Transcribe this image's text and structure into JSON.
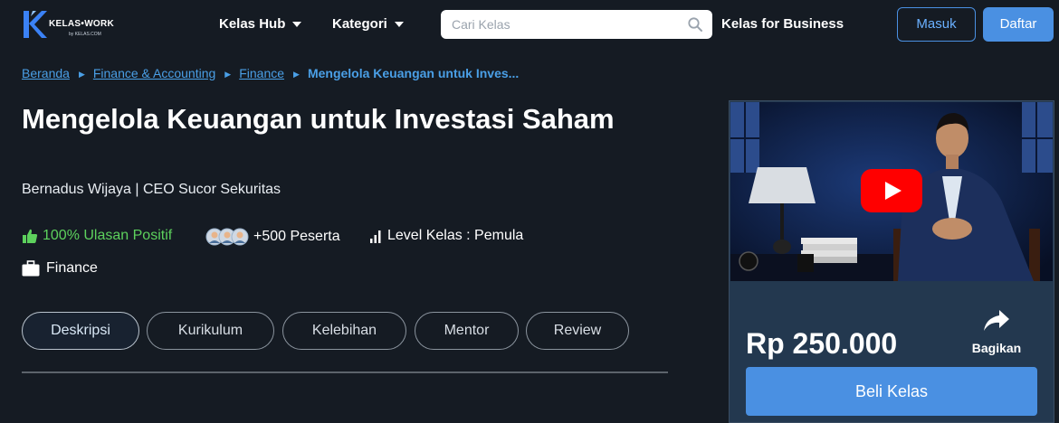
{
  "logo": {
    "brand": "KELAS•WORK",
    "sub": "by KELAS.COM"
  },
  "nav": {
    "menu": [
      {
        "label": "Kelas Hub"
      },
      {
        "label": "Kategori"
      }
    ],
    "search_placeholder": "Cari Kelas",
    "business": "Kelas for Business",
    "login": "Masuk",
    "register": "Daftar"
  },
  "breadcrumb": {
    "items": [
      "Beranda",
      "Finance & Accounting",
      "Finance"
    ],
    "current": "Mengelola Keuangan untuk Inves..."
  },
  "course": {
    "title": "Mengelola Keuangan untuk Investasi Saham",
    "mentor": "Bernadus Wijaya | CEO Sucor Sekuritas",
    "review": "100% Ulasan Positif",
    "participants": "+500 Peserta",
    "level": "Level Kelas : Pemula",
    "category": "Finance"
  },
  "tabs": [
    "Deskripsi",
    "Kurikulum",
    "Kelebihan",
    "Mentor",
    "Review"
  ],
  "active_tab": "Deskripsi",
  "card": {
    "price": "Rp 250.000",
    "share": "Bagikan",
    "buy": "Beli Kelas"
  },
  "colors": {
    "background": "#151b23",
    "accent": "#4a90e2",
    "link": "#4a9fe6",
    "positive": "#5dd15d",
    "play": "#ff0000"
  }
}
